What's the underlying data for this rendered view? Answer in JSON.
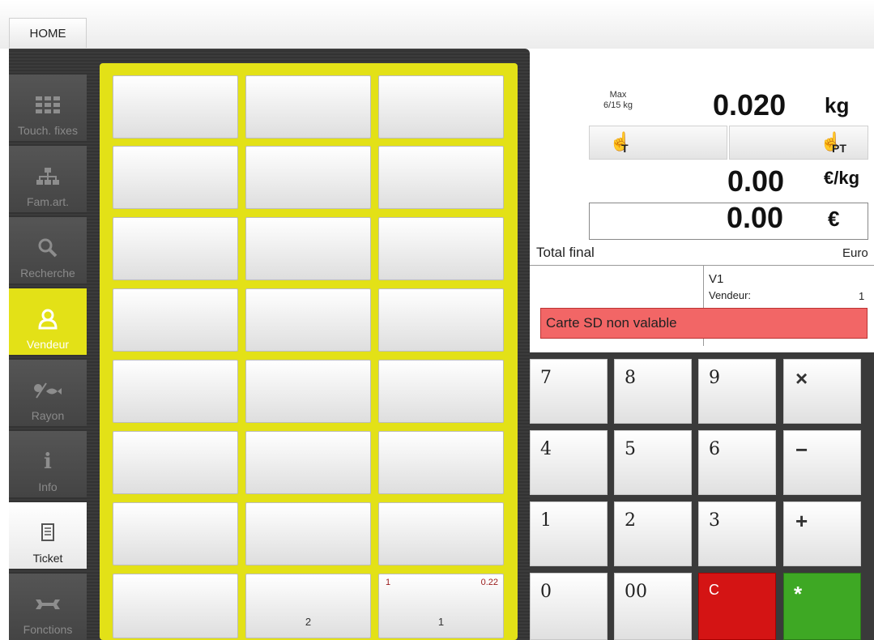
{
  "header": {
    "home_tab": "HOME"
  },
  "sidebar": {
    "items": [
      {
        "label": "Touch. fixes",
        "icon": "grid-icon",
        "state": "disabled"
      },
      {
        "label": "Fam.art.",
        "icon": "hierarchy-icon",
        "state": "disabled"
      },
      {
        "label": "Recherche",
        "icon": "search-icon",
        "state": "disabled"
      },
      {
        "label": "Vendeur",
        "icon": "user-icon",
        "state": "active"
      },
      {
        "label": "Rayon",
        "icon": "meat-fish-icon",
        "state": "disabled"
      },
      {
        "label": "Info",
        "icon": "info-icon",
        "state": "disabled"
      },
      {
        "label": "Ticket",
        "icon": "receipt-icon",
        "state": "enabled"
      },
      {
        "label": "Fonctions",
        "icon": "wrench-icon",
        "state": "disabled"
      }
    ]
  },
  "product_grid": {
    "filled_buttons": [
      {
        "label": "2",
        "qty": "",
        "price": ""
      },
      {
        "label": "1",
        "qty": "1",
        "price": "0.22"
      }
    ]
  },
  "scale": {
    "max_line1": "Max",
    "max_line2": "6/15 kg",
    "weight": "0.020",
    "weight_unit": "kg",
    "tare_sub": "T",
    "preset_tare_sub": "PT",
    "price_per_kg": "0.00",
    "price_per_kg_unit": "€/kg",
    "total": "0.00",
    "total_unit": "€"
  },
  "ticket": {
    "total_label": "Total final",
    "currency": "Euro",
    "vendor_code": "V1",
    "vendor_label": "Vendeur:",
    "vendor_value": "1"
  },
  "error_message": "Carte SD non valable",
  "keypad": {
    "keys": [
      "7",
      "8",
      "9",
      "×",
      "4",
      "5",
      "6",
      "−",
      "1",
      "2",
      "3",
      "+",
      "0",
      "00",
      "C",
      "*"
    ]
  },
  "colors": {
    "accent_yellow": "#e3e117",
    "error_red": "#f26666",
    "clear_red": "#d41414",
    "enter_green": "#3ea824"
  }
}
